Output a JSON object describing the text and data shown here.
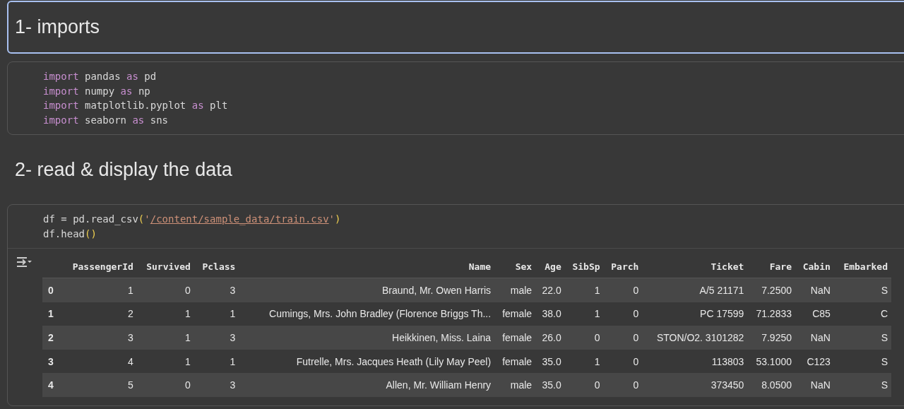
{
  "cells": [
    {
      "kind": "markdown",
      "selected": true,
      "text": "1- imports"
    },
    {
      "kind": "code",
      "selected": false,
      "lines": [
        [
          {
            "kind": "keyword",
            "text": "import"
          },
          {
            "kind": "plain",
            "text": " pandas "
          },
          {
            "kind": "keyword",
            "text": "as"
          },
          {
            "kind": "plain",
            "text": " pd"
          }
        ],
        [
          {
            "kind": "keyword",
            "text": "import"
          },
          {
            "kind": "plain",
            "text": " numpy "
          },
          {
            "kind": "keyword",
            "text": "as"
          },
          {
            "kind": "plain",
            "text": " np"
          }
        ],
        [
          {
            "kind": "keyword",
            "text": "import"
          },
          {
            "kind": "plain",
            "text": " matplotlib.pyplot "
          },
          {
            "kind": "keyword",
            "text": "as"
          },
          {
            "kind": "plain",
            "text": " plt"
          }
        ],
        [
          {
            "kind": "keyword",
            "text": "import"
          },
          {
            "kind": "plain",
            "text": " seaborn "
          },
          {
            "kind": "keyword",
            "text": "as"
          },
          {
            "kind": "plain",
            "text": " sns"
          }
        ]
      ]
    },
    {
      "kind": "markdown",
      "selected": false,
      "text": "2- read & display the data"
    },
    {
      "kind": "code",
      "selected": false,
      "lines": [
        [
          {
            "kind": "plain",
            "text": "df = pd.read_csv"
          },
          {
            "kind": "paren",
            "text": "("
          },
          {
            "kind": "string",
            "text": "'"
          },
          {
            "kind": "path",
            "text": "/content/sample_data/train.csv"
          },
          {
            "kind": "string",
            "text": "'"
          },
          {
            "kind": "paren",
            "text": ")"
          }
        ],
        [
          {
            "kind": "plain",
            "text": "df.head"
          },
          {
            "kind": "paren",
            "text": "()"
          }
        ]
      ],
      "output": {
        "columns": [
          "PassengerId",
          "Survived",
          "Pclass",
          "Name",
          "Sex",
          "Age",
          "SibSp",
          "Parch",
          "Ticket",
          "Fare",
          "Cabin",
          "Embarked"
        ],
        "rows": [
          {
            "index": "0",
            "cells": [
              "1",
              "0",
              "3",
              "Braund, Mr. Owen Harris",
              "male",
              "22.0",
              "1",
              "0",
              "A/5 21171",
              "7.2500",
              "NaN",
              "S"
            ]
          },
          {
            "index": "1",
            "cells": [
              "2",
              "1",
              "1",
              "Cumings, Mrs. John Bradley (Florence Briggs Th...",
              "female",
              "38.0",
              "1",
              "0",
              "PC 17599",
              "71.2833",
              "C85",
              "C"
            ]
          },
          {
            "index": "2",
            "cells": [
              "3",
              "1",
              "3",
              "Heikkinen, Miss. Laina",
              "female",
              "26.0",
              "0",
              "0",
              "STON/O2. 3101282",
              "7.9250",
              "NaN",
              "S"
            ]
          },
          {
            "index": "3",
            "cells": [
              "4",
              "1",
              "1",
              "Futrelle, Mrs. Jacques Heath (Lily May Peel)",
              "female",
              "35.0",
              "1",
              "0",
              "113803",
              "53.1000",
              "C123",
              "S"
            ]
          },
          {
            "index": "4",
            "cells": [
              "5",
              "0",
              "3",
              "Allen, Mr. William Henry",
              "male",
              "35.0",
              "0",
              "0",
              "373450",
              "8.0500",
              "NaN",
              "S"
            ]
          }
        ]
      }
    }
  ]
}
